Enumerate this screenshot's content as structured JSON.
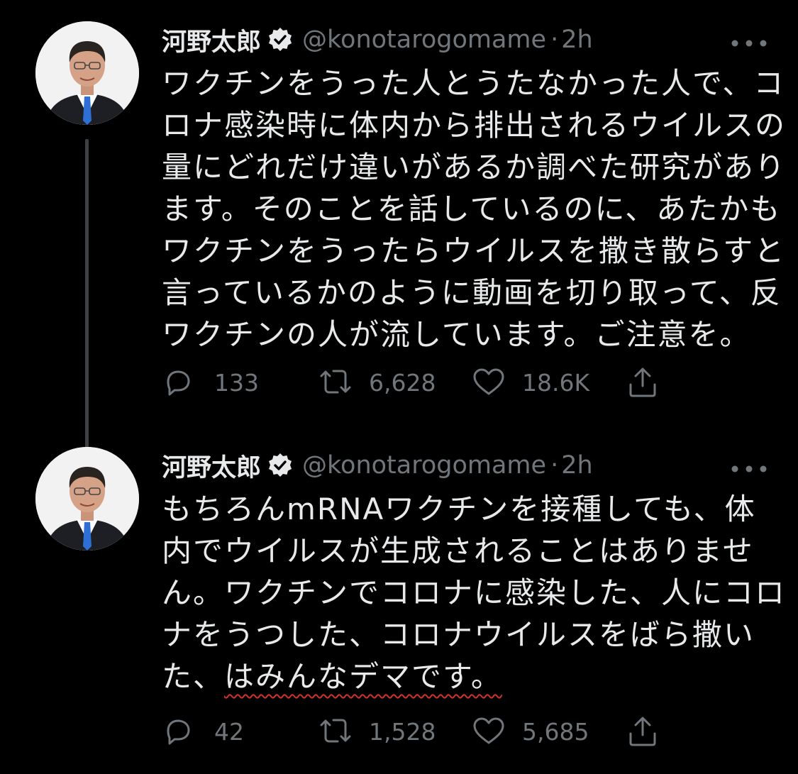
{
  "tweets": [
    {
      "author_name": "河野太郎",
      "handle": "@konotarogomame",
      "separator": "·",
      "time": "2h",
      "text_lines": [
        "ワクチンをうった人とうたなかった人で、コ",
        "ロナ感染時に体内から排出されるウイルスの",
        "量にどれだけ違いがあるか調べた研究があり",
        "ます。そのことを話しているのに、あたかも",
        "ワクチンをうったらウイルスを撒き散らすと",
        "言っているかのように動画を切り取って、反",
        "ワクチンの人が流しています。ご注意を。"
      ],
      "replies": "133",
      "retweets": "6,628",
      "likes": "18.6K"
    },
    {
      "author_name": "河野太郎",
      "handle": "@konotarogomame",
      "separator": "·",
      "time": "2h",
      "text_lines": [
        "もちろんmRNAワクチンを接種しても、体",
        "内でウイルスが生成されることはありませ",
        "ん。ワクチンでコロナに感染した、人にコロ",
        "ナをうつした、コロナウイルスをばら撒い"
      ],
      "last_line_prefix": "た、",
      "last_line_underlined": "はみんなデマです。",
      "replies": "42",
      "retweets": "1,528",
      "likes": "5,685"
    }
  ],
  "icons": {
    "verified": "verified-badge-icon",
    "more": "more-options-icon",
    "reply": "reply-icon",
    "retweet": "retweet-icon",
    "like": "like-icon",
    "share": "share-icon"
  },
  "colors": {
    "background": "#000000",
    "text": "#e7e9ea",
    "secondary": "#71767b",
    "thread_line": "#3d4145",
    "underline": "#d2322d"
  }
}
